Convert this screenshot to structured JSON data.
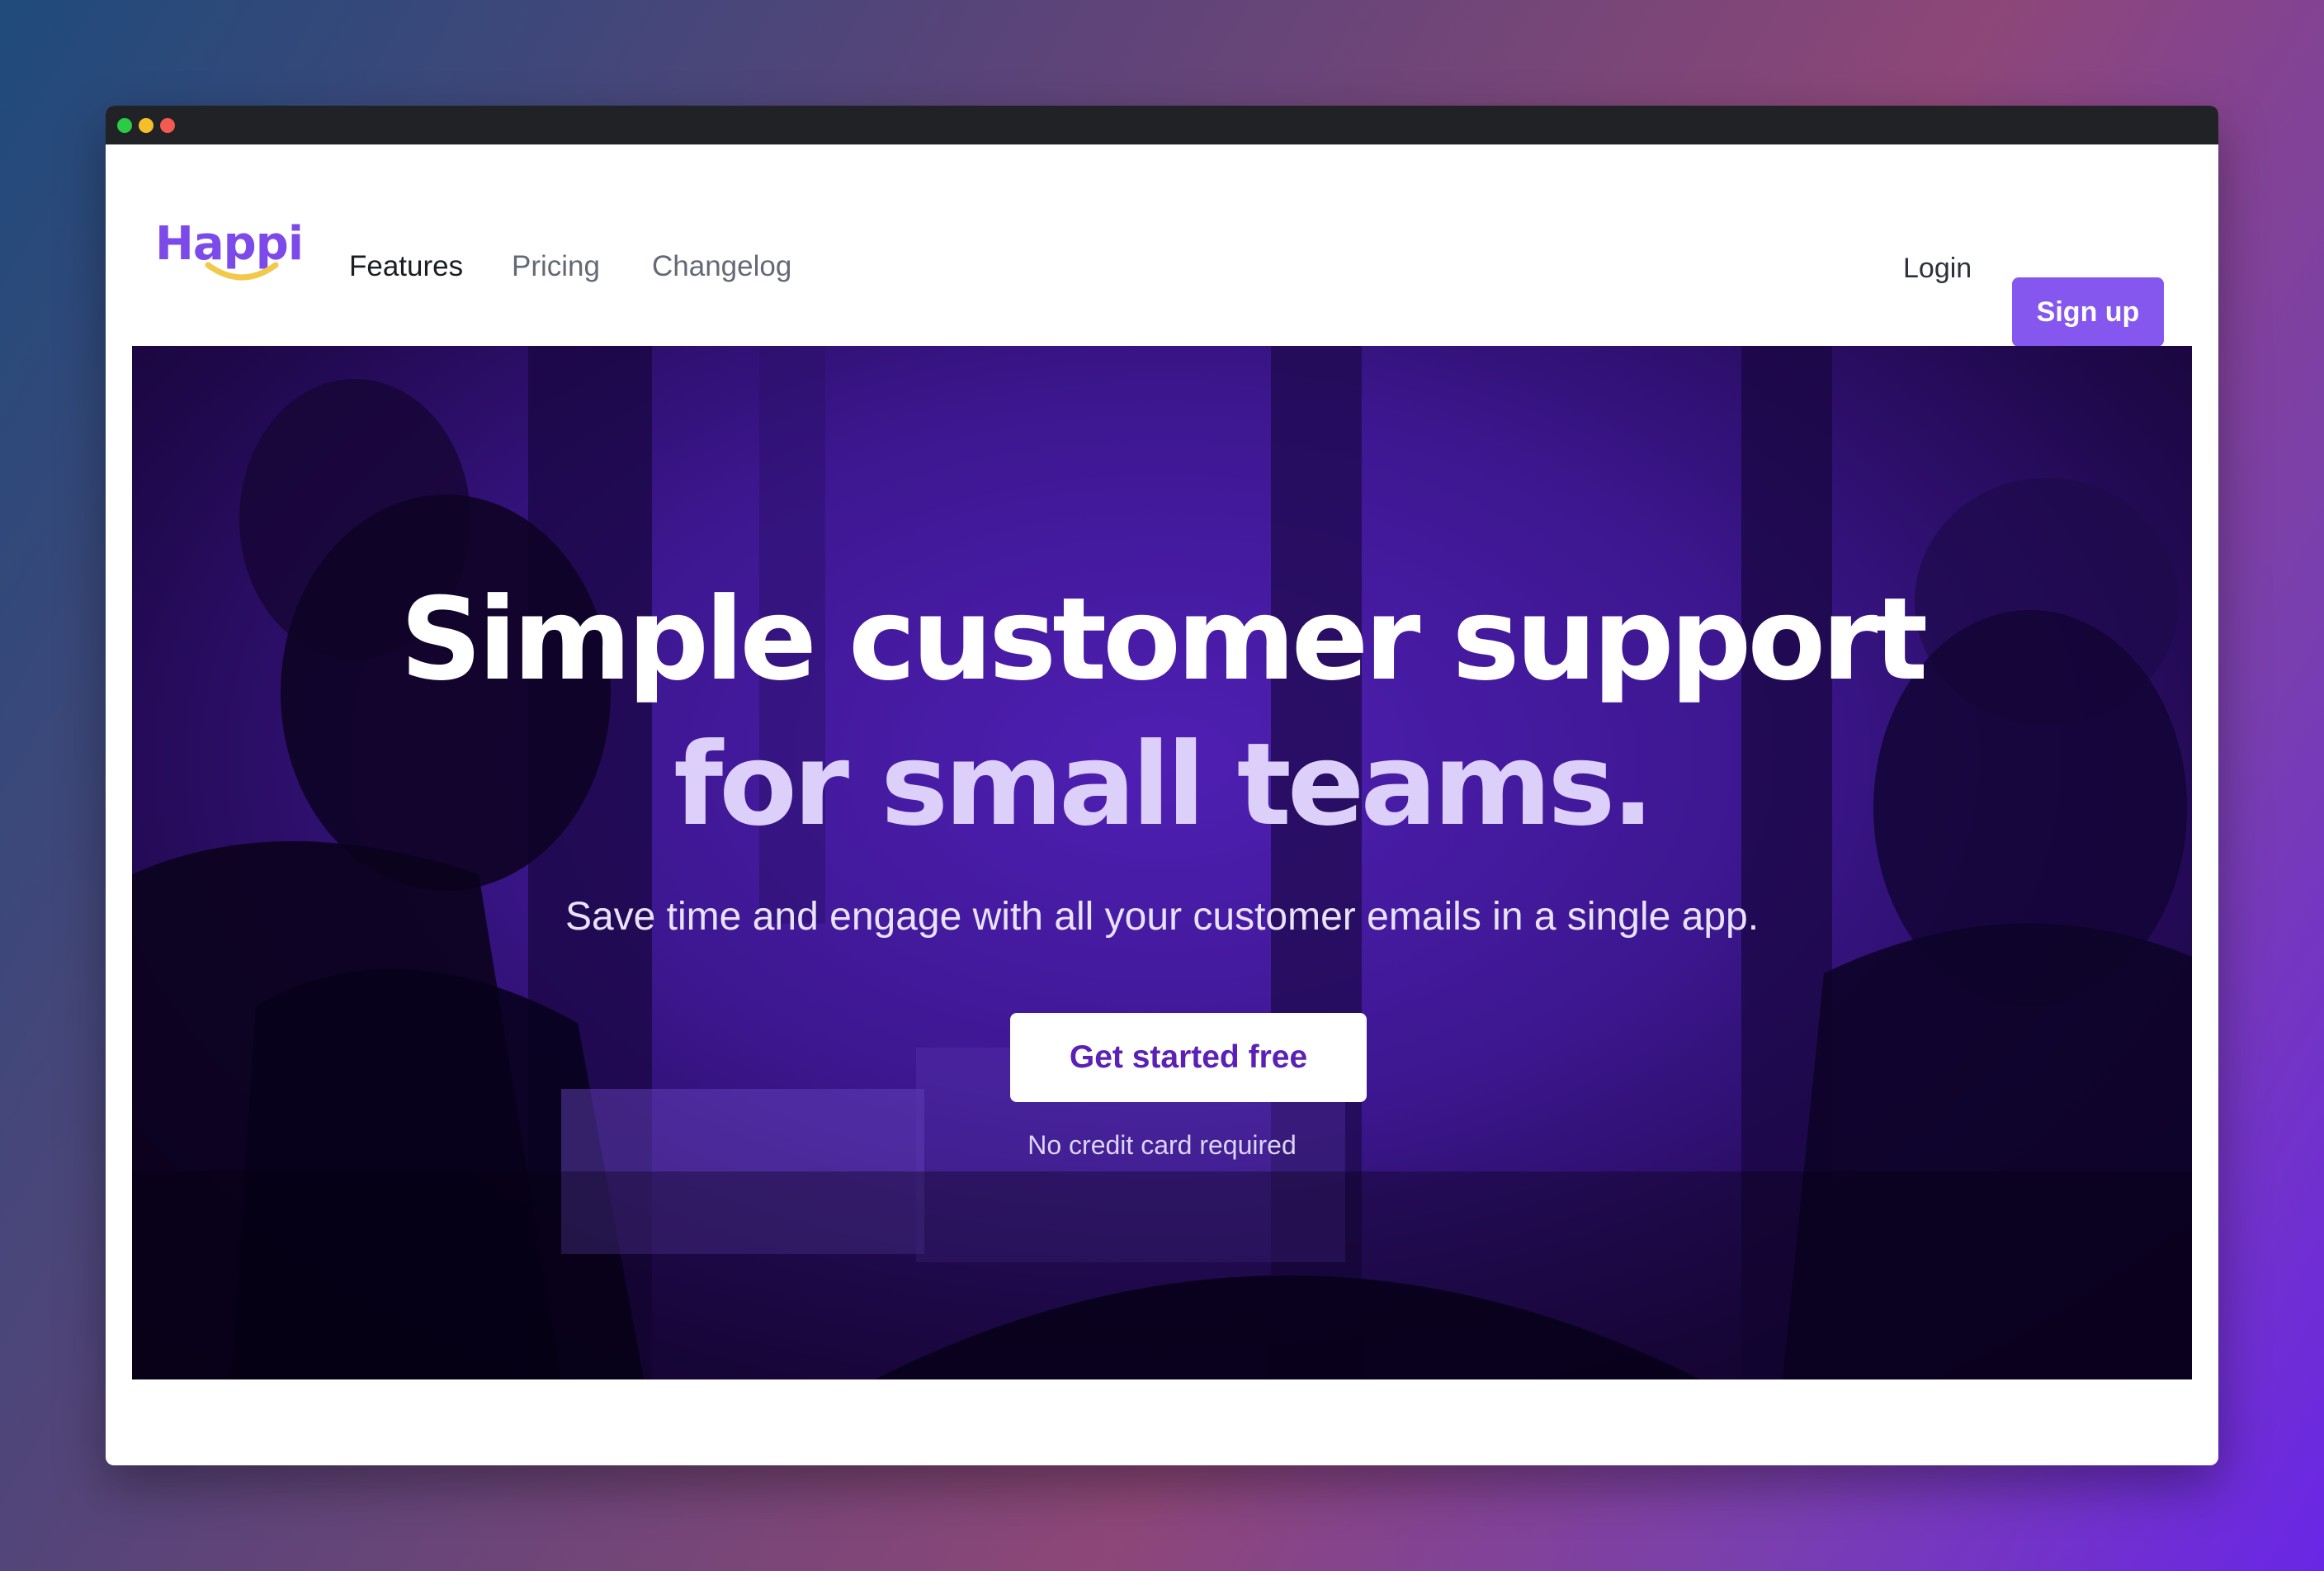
{
  "window": {
    "controls": [
      "green-dot",
      "yellow-dot",
      "red-dot"
    ]
  },
  "brand": {
    "name": "Happi",
    "color": "#7c4ae8",
    "smile_color": "#f2c94c"
  },
  "nav": {
    "links": [
      {
        "label": "Features",
        "active": true
      },
      {
        "label": "Pricing",
        "active": false
      },
      {
        "label": "Changelog",
        "active": false
      }
    ],
    "login_label": "Login",
    "signup_label": "Sign up"
  },
  "hero": {
    "title_line1": "Simple customer support",
    "title_line2": "for small teams.",
    "subtitle": "Save time and engage with all your customer emails in a single app.",
    "cta_label": "Get started free",
    "cta_note": "No credit card required",
    "overlay_color": "#4c1d95"
  },
  "colors": {
    "accent": "#8657ee",
    "dark": "#202225"
  }
}
